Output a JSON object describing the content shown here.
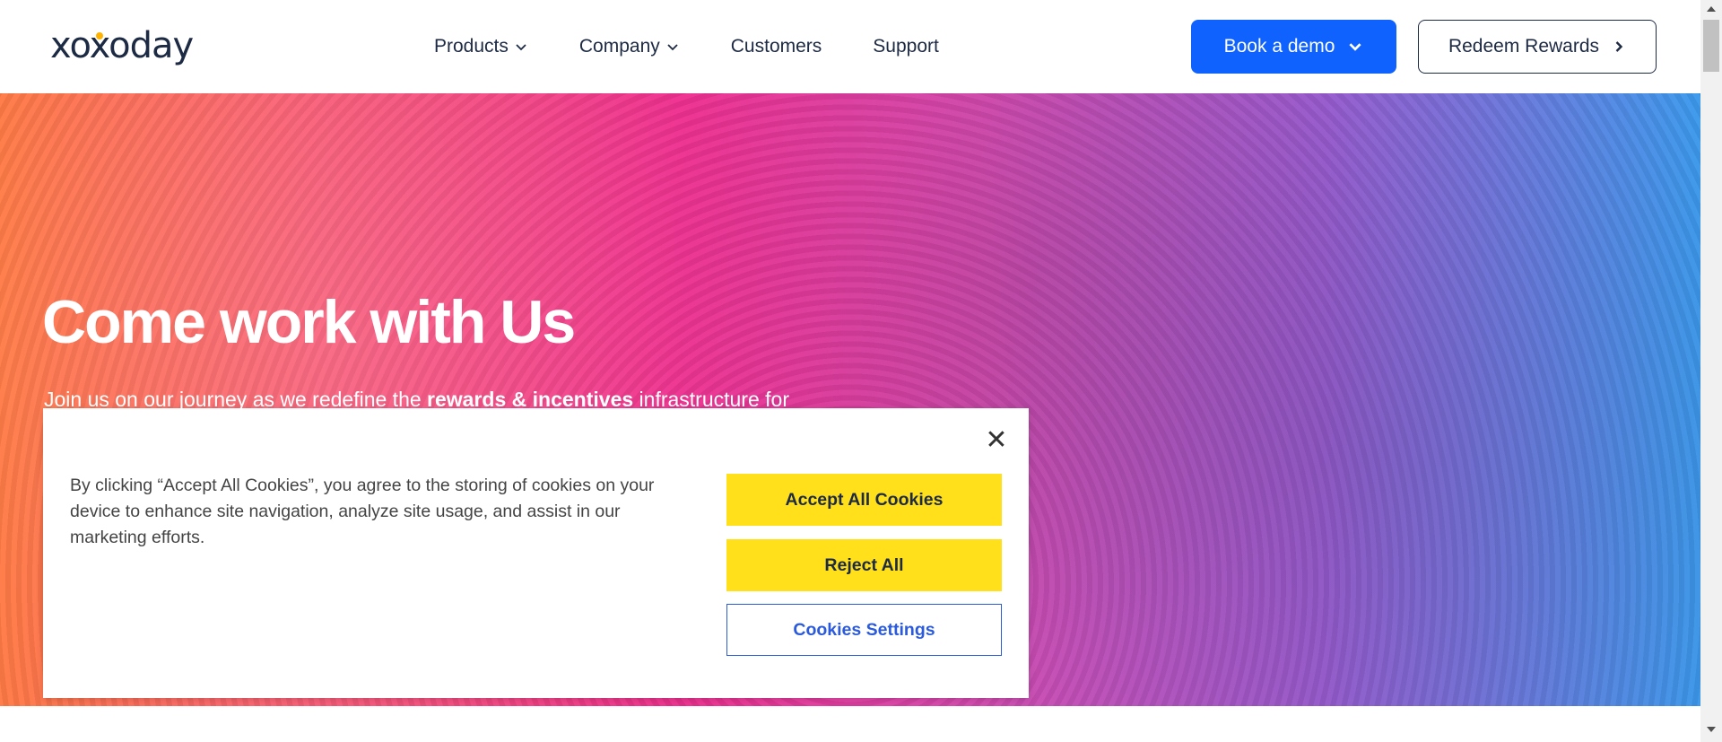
{
  "header": {
    "logo_text": "xoxoday",
    "nav": [
      {
        "label": "Products",
        "has_dropdown": true
      },
      {
        "label": "Company",
        "has_dropdown": true
      },
      {
        "label": "Customers",
        "has_dropdown": false
      },
      {
        "label": "Support",
        "has_dropdown": false
      }
    ],
    "book_demo_label": "Book a demo",
    "redeem_label": "Redeem Rewards"
  },
  "hero": {
    "title": "Come work with Us",
    "subtitle_pre": "Join us on our journey as we redefine the ",
    "subtitle_bold": "rewards & incentives",
    "subtitle_post": " infrastructure for"
  },
  "cookie_banner": {
    "text": "By clicking “Accept All Cookies”, you agree to the storing of cookies on your device to enhance site navigation, analyze site usage, and assist in our marketing efforts.",
    "accept_label": "Accept All Cookies",
    "reject_label": "Reject All",
    "settings_label": "Cookies Settings",
    "close_glyph": "✕"
  },
  "colors": {
    "primary_blue": "#0f62fe",
    "accent_yellow": "#ffe01b",
    "link_blue": "#2b5adb",
    "text_dark": "#1d2a44"
  }
}
